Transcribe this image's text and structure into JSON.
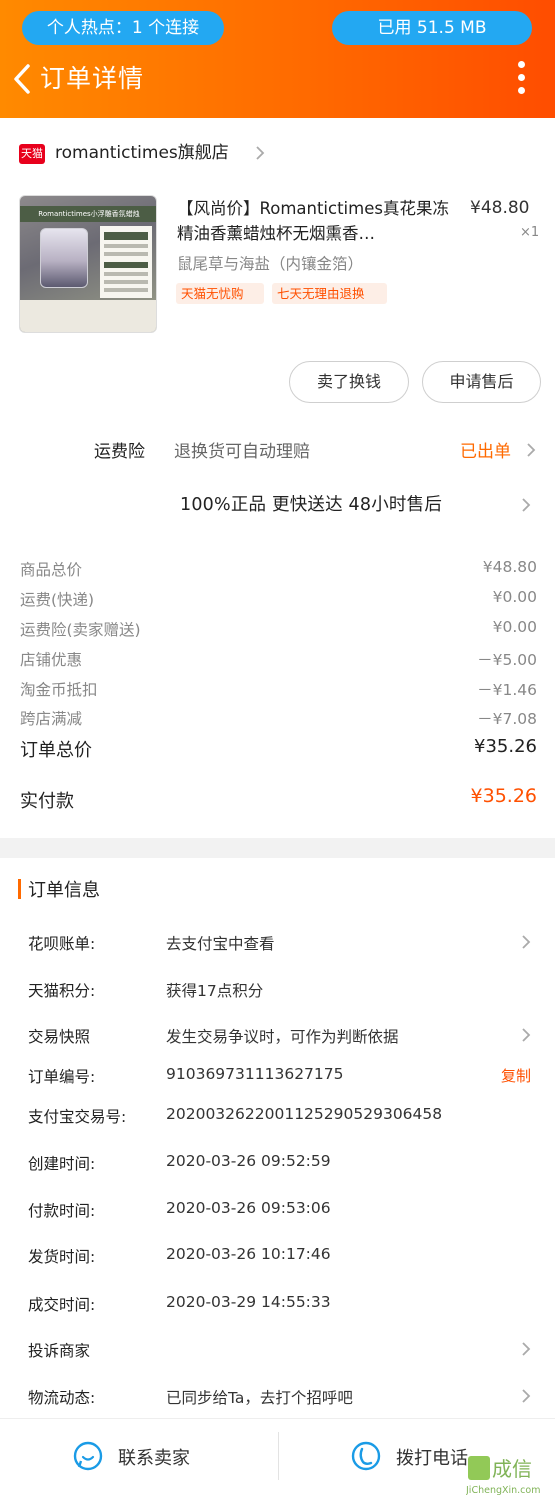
{
  "status_bar": {
    "hotspot": "个人热点：1 个连接",
    "data_used": "已用 51.5 MB"
  },
  "nav": {
    "title": "订单详情"
  },
  "shop": {
    "platform_badge": "天猫",
    "name": "romantictimes旗舰店"
  },
  "product": {
    "thumb_band": "Romantictimes小浮雕香氛蜡烛",
    "title": "【风尚价】Romantictimes真花果冻精油香薰蜡烛杯无烟熏香…",
    "price": "¥48.80",
    "qty": "×1",
    "sku": "鼠尾草与海盐（内镶金箔）",
    "tags": [
      "天猫无忧购",
      "七天无理由退换"
    ]
  },
  "actions": {
    "sell_label": "卖了换钱",
    "aftersale_label": "申请售后"
  },
  "insurance": {
    "label": "运费险",
    "desc": "退换货可自动理赔",
    "status": "已出单"
  },
  "guarantee": "100%正品  更快送达  48小时售后",
  "fees": [
    {
      "label": "商品总价",
      "value": "¥48.80"
    },
    {
      "label": "运费(快递)",
      "value": "¥0.00"
    },
    {
      "label": "运费险(卖家赠送)",
      "value": "¥0.00"
    },
    {
      "label": "店铺优惠",
      "value": "－¥5.00"
    },
    {
      "label": "淘金币抵扣",
      "value": "－¥1.46"
    },
    {
      "label": "跨店满减",
      "value": "－¥7.08"
    }
  ],
  "total": {
    "label": "订单总价",
    "value": "¥35.26"
  },
  "paid": {
    "label": "实付款",
    "value": "¥35.26"
  },
  "order_info": {
    "title": "订单信息",
    "rows": [
      {
        "label": "花呗账单:",
        "value": "去支付宝中查看"
      },
      {
        "label": "天猫积分:",
        "value": "获得17点积分"
      },
      {
        "label": "交易快照",
        "value": "发生交易争议时，可作为判断依据"
      },
      {
        "label": "订单编号:",
        "value": "910369731113627175"
      },
      {
        "label": "支付宝交易号:",
        "value": "2020032622001125290529306458"
      },
      {
        "label": "创建时间:",
        "value": "2020-03-26 09:52:59"
      },
      {
        "label": "付款时间:",
        "value": "2020-03-26 09:53:06"
      },
      {
        "label": "发货时间:",
        "value": "2020-03-26 10:17:46"
      },
      {
        "label": "成交时间:",
        "value": "2020-03-29 14:55:33"
      },
      {
        "label": "投诉商家",
        "value": ""
      },
      {
        "label": "物流动态:",
        "value": "已同步给Ta，去打个招呼吧"
      }
    ],
    "copy_label": "复制"
  },
  "footer": {
    "contact_label": "联系卖家",
    "call_label": "拨打电话"
  },
  "colors": {
    "accent": "#ff6a00",
    "price_red": "#ff5000",
    "pill_blue": "#23a8f2",
    "tmall_red": "#e8001c"
  },
  "icons": [
    "back-arrow-icon",
    "more-dots-icon",
    "chevron-right-icon",
    "chat-icon",
    "phone-icon"
  ],
  "watermark": {
    "brand": "集成信",
    "site": "JiChengXin.com"
  }
}
